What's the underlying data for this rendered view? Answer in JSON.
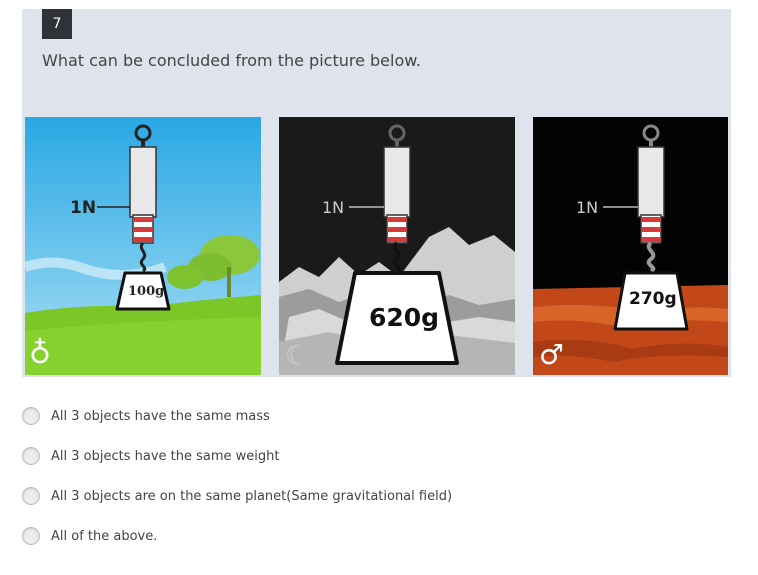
{
  "question": {
    "number": "7",
    "text": "What can be concluded from the picture below."
  },
  "panels": [
    {
      "force_label": "1N",
      "mass_label": "100g",
      "planet_symbol": "earth-symbol",
      "planet_glyph": "♁"
    },
    {
      "force_label": "1N",
      "mass_label": "620g",
      "planet_symbol": "moon-symbol",
      "planet_glyph": "☾"
    },
    {
      "force_label": "1N",
      "mass_label": "270g",
      "planet_symbol": "mars-symbol",
      "planet_glyph": "♂"
    }
  ],
  "options": [
    {
      "label": "All 3 objects have the same mass"
    },
    {
      "label": "All 3 objects have the same weight"
    },
    {
      "label": "All 3 objects are on the same planet(Same gravitational field)"
    },
    {
      "label": "All of the above."
    }
  ],
  "colors": {
    "card_bg": "#dfe4ec",
    "number_badge": "#2f3337",
    "earth_sky": "#33b5e8",
    "earth_grass": "#7dc728",
    "moon_bg": "#1a1a1a",
    "mars_ground": "#c2461a",
    "spring_red": "#d63a3a"
  }
}
